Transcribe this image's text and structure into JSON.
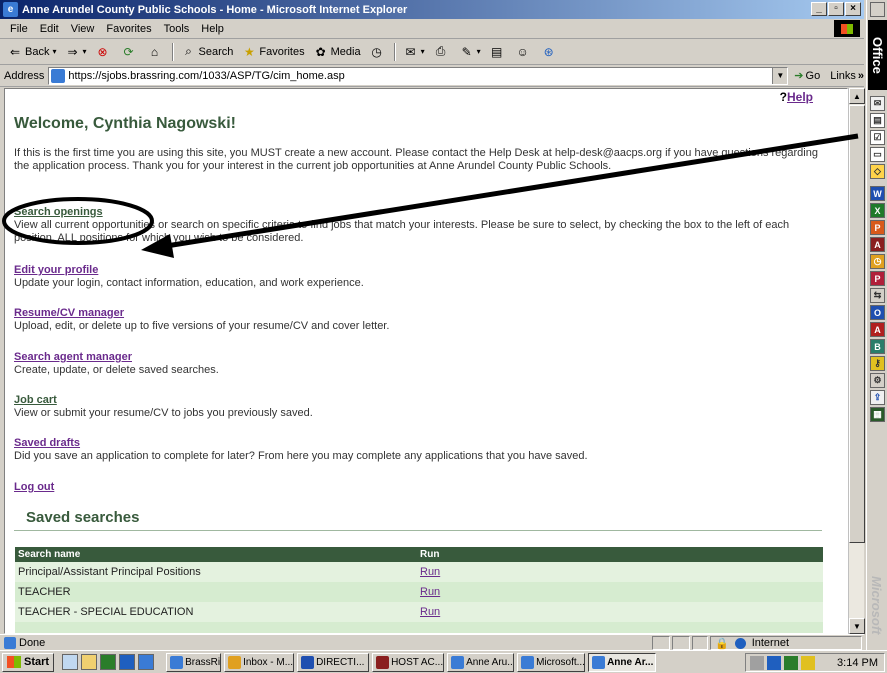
{
  "window": {
    "title": "Anne Arundel County Public Schools - Home - Microsoft Internet Explorer",
    "minimize": "_",
    "maximize": "▫",
    "close": "×"
  },
  "menu": [
    "File",
    "Edit",
    "View",
    "Favorites",
    "Tools",
    "Help"
  ],
  "toolbar": {
    "back": "Back",
    "search": "Search",
    "favorites": "Favorites",
    "media": "Media"
  },
  "address": {
    "label": "Address",
    "url": "https://sjobs.brassring.com/1033/ASP/TG/cim_home.asp",
    "go": "Go",
    "links": "Links"
  },
  "page": {
    "help": "Help",
    "help_mark": "?",
    "welcome": "Welcome, Cynthia Nagowski!",
    "intro": "If this is the first time you are using this site, you MUST create a new account. Please contact the Help Desk at help-desk@aacps.org if you have questions regarding the application process. Thank you for your interest in the current job opportunities at Anne Arundel County Public Schools.",
    "sections": [
      {
        "link": "Search openings",
        "desc": "View all current opportunities or search on specific criteria to find jobs that match your interests. Please be sure to select, by checking the box to the left of each position, ALL positions for which you wish to be considered."
      },
      {
        "link": "Edit your profile",
        "desc": "Update your login, contact information, education, and work experience."
      },
      {
        "link": "Resume/CV manager",
        "desc": "Upload, edit, or delete up to five versions of your resume/CV and cover letter."
      },
      {
        "link": "Search agent manager",
        "desc": "Create, update, or delete saved searches."
      },
      {
        "link": "Job cart",
        "desc": "View or submit your resume/CV to jobs you previously saved."
      },
      {
        "link": "Saved drafts",
        "desc": "Did you save an application to complete for later? From here you may complete any applications that you have saved."
      }
    ],
    "logout": "Log out",
    "saved_title": "Saved searches",
    "table": {
      "headers": [
        "Search name",
        "Run"
      ],
      "rows": [
        [
          "Principal/Assistant Principal Positions",
          "Run"
        ],
        [
          "TEACHER",
          "Run"
        ],
        [
          "TEACHER - SPECIAL EDUCATION",
          "Run"
        ]
      ]
    }
  },
  "status": {
    "text": "Done",
    "zone": "Internet"
  },
  "officebar": {
    "title": "Office",
    "brand": "Microsoft"
  },
  "taskbar": {
    "start": "Start",
    "tasks": [
      "BrassRin...",
      "Inbox - M...",
      "DIRECTI...",
      "HOST AC...",
      "Anne Aru...",
      "Microsoft...",
      "Anne Ar..."
    ],
    "clock": "3:14 PM"
  },
  "colors": {
    "heading_green": "#385a3c",
    "link_purple": "#6a2a8c",
    "table_header": "#385a3c",
    "table_row": "#d6ecd0",
    "titlebar": "#0a246a"
  }
}
